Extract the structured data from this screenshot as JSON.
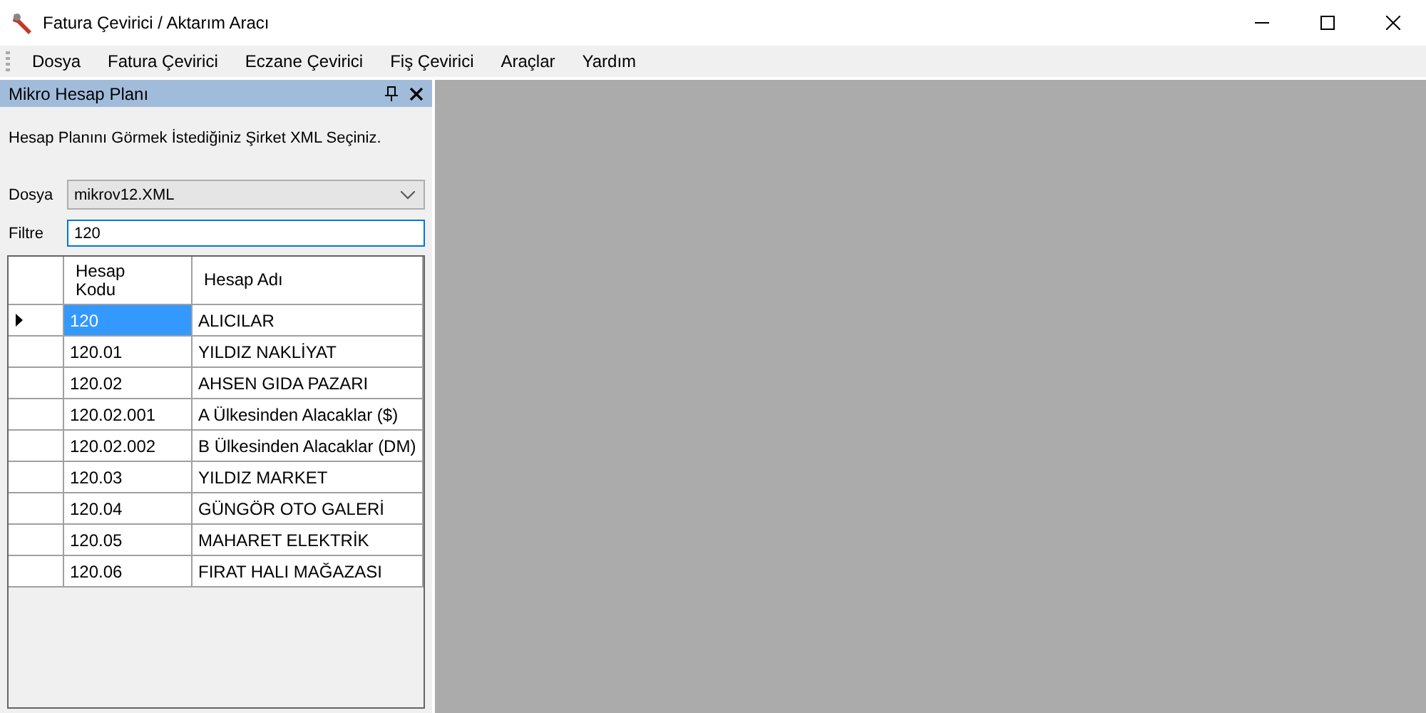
{
  "window": {
    "title": "Fatura Çevirici / Aktarım Aracı"
  },
  "menu": [
    "Dosya",
    "Fatura Çevirici",
    "Eczane Çevirici",
    "Fiş Çevirici",
    "Araçlar",
    "Yardım"
  ],
  "panel": {
    "title": "Mikro Hesap Planı",
    "instruction": "Hesap Planını Görmek İstediğiniz Şirket XML Seçiniz.",
    "file_label": "Dosya",
    "file_value": "mikrov12.XML",
    "filter_label": "Filtre",
    "filter_value": "120",
    "table": {
      "columns": [
        "Hesap\nKodu",
        "Hesap Adı"
      ],
      "rows": [
        {
          "code": "120",
          "name": "ALICILAR",
          "selected": true
        },
        {
          "code": "120.01",
          "name": "YILDIZ NAKLİYAT",
          "selected": false
        },
        {
          "code": "120.02",
          "name": "AHSEN GIDA PAZARI",
          "selected": false
        },
        {
          "code": "120.02.001",
          "name": "A Ülkesinden Alacaklar ($)",
          "selected": false
        },
        {
          "code": "120.02.002",
          "name": "B Ülkesinden Alacaklar (DM)",
          "selected": false
        },
        {
          "code": "120.03",
          "name": "YILDIZ MARKET",
          "selected": false
        },
        {
          "code": "120.04",
          "name": "GÜNGÖR OTO GALERİ",
          "selected": false
        },
        {
          "code": "120.05",
          "name": "MAHARET ELEKTRİK",
          "selected": false
        },
        {
          "code": "120.06",
          "name": "FIRAT HALI MAĞAZASI",
          "selected": false
        }
      ]
    }
  }
}
